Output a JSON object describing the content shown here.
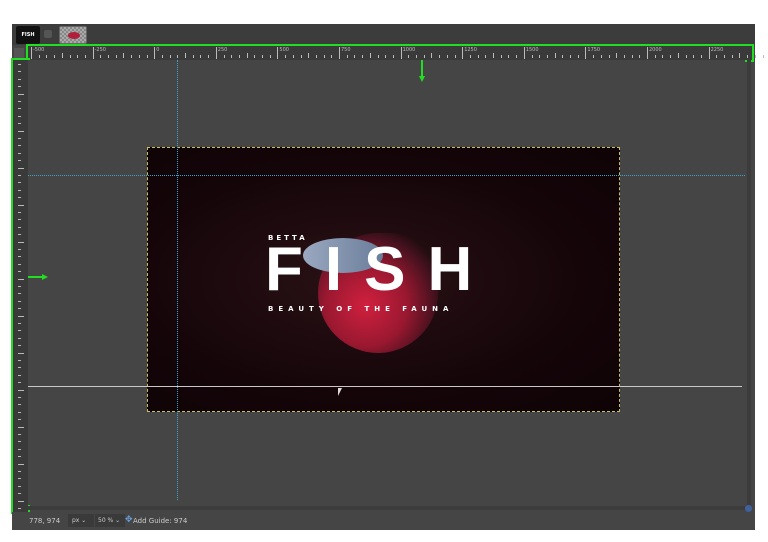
{
  "tabs": [
    {
      "label": "FISH"
    },
    {
      "label": ""
    }
  ],
  "ruler": {
    "labels": [
      "-500",
      "-250",
      "0",
      "250",
      "500",
      "750",
      "1000",
      "1250",
      "1500",
      "1750",
      "2000",
      "2250"
    ]
  },
  "image": {
    "title_small": "BETTA",
    "title_large": "FISH",
    "subtitle": "BEAUTY OF THE FAUNA"
  },
  "status": {
    "coords": "778, 974",
    "unit": "px",
    "zoom": "50 %",
    "message": "Add Guide: 974"
  },
  "colors": {
    "annotation": "#22dd22",
    "guide": "#3aa6c8"
  }
}
